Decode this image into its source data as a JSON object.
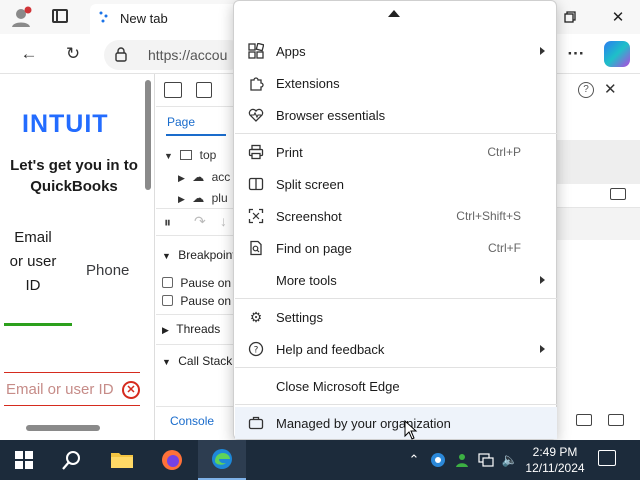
{
  "browser": {
    "tab_title": "New tab",
    "url": "https://accou",
    "window_controls": [
      "minimize-icon",
      "restore-icon",
      "close-icon"
    ]
  },
  "page": {
    "logo": "INTUIT",
    "headline": "Let's get you in to QuickBooks",
    "option_email": "Email or user ID",
    "option_phone": "Phone",
    "email_placeholder": "Email or user ID",
    "error_icon": "error-circle-icon"
  },
  "devtools": {
    "sources_tab": "Page",
    "tree": {
      "root": "top",
      "child1": "acc",
      "child2": "plu"
    },
    "sections": {
      "breakpoints": "Breakpoint",
      "pause1": "Pause on u",
      "pause2": "Pause on c",
      "threads": "Threads",
      "callstack": "Call Stack"
    },
    "console_tab": "Console"
  },
  "menu": {
    "items": [
      {
        "label": "Apps",
        "icon": "apps-icon",
        "submenu": true
      },
      {
        "label": "Extensions",
        "icon": "extensions-icon"
      },
      {
        "label": "Browser essentials",
        "icon": "heart-icon"
      },
      {
        "label": "Print",
        "icon": "print-icon",
        "shortcut": "Ctrl+P"
      },
      {
        "label": "Split screen",
        "icon": "split-screen-icon"
      },
      {
        "label": "Screenshot",
        "icon": "screenshot-icon",
        "shortcut": "Ctrl+Shift+S"
      },
      {
        "label": "Find on page",
        "icon": "find-icon",
        "shortcut": "Ctrl+F"
      },
      {
        "label": "More tools",
        "submenu": true
      },
      {
        "label": "Settings",
        "icon": "gear-icon"
      },
      {
        "label": "Help and feedback",
        "icon": "help-icon",
        "submenu": true
      },
      {
        "label": "Close Microsoft Edge"
      },
      {
        "label": "Managed by your organization",
        "icon": "briefcase-icon"
      }
    ]
  },
  "taskbar": {
    "time": "2:49 PM",
    "date": "12/11/2024"
  },
  "colors": {
    "intuit_blue": "#236cff",
    "error_red": "#d52b1e",
    "active_green": "#2ca01c",
    "taskbar": "#1c2b3b"
  }
}
